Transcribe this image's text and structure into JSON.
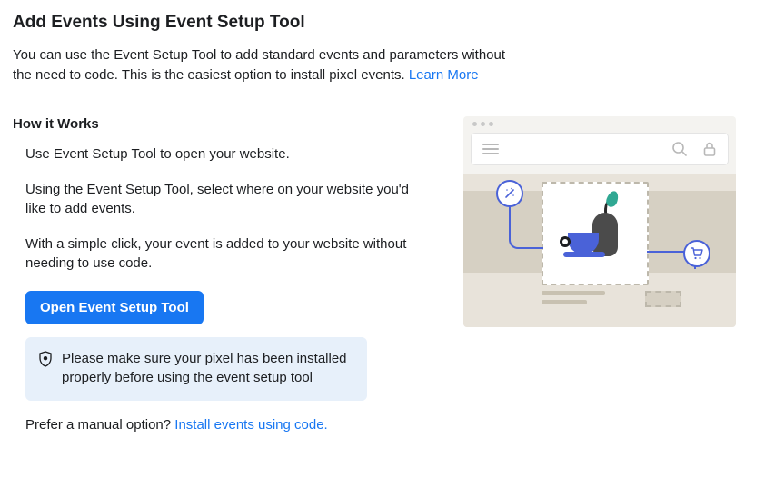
{
  "title": "Add Events Using Event Setup Tool",
  "intro": {
    "text": "You can use the Event Setup Tool to add standard events and parameters without the need to code. This is the easiest option to install pixel events. ",
    "learn_more": "Learn More"
  },
  "how_it_works": {
    "heading": "How it Works",
    "steps": [
      "Use Event Setup Tool to open your website.",
      "Using the Event Setup Tool, select where on your website you'd like to add events.",
      "With a simple click, your event is added to your website without needing to use code."
    ]
  },
  "cta": "Open Event Setup Tool",
  "notice": "Please make sure your pixel has been installed properly before using the event setup tool",
  "manual": {
    "prefix": "Prefer a manual option? ",
    "link": "Install events using code."
  }
}
